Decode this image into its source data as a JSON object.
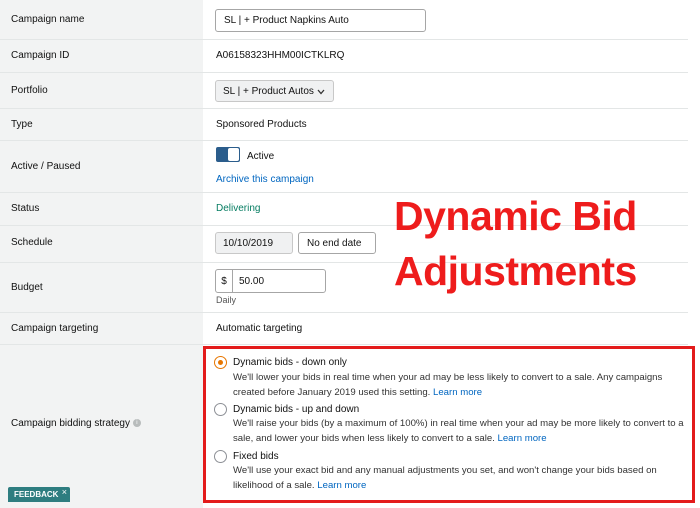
{
  "rows": {
    "campaign_name": {
      "label": "Campaign name",
      "value": "SL | + Product Napkins Auto"
    },
    "campaign_id": {
      "label": "Campaign ID",
      "value": "A06158323HHM00ICTKLRQ"
    },
    "portfolio": {
      "label": "Portfolio",
      "value": "SL | + Product Autos"
    },
    "type": {
      "label": "Type",
      "value": "Sponsored Products"
    },
    "active_paused": {
      "label": "Active / Paused",
      "toggle_label": "Active",
      "archive_link": "Archive this campaign"
    },
    "status": {
      "label": "Status",
      "value": "Delivering"
    },
    "schedule": {
      "label": "Schedule",
      "start_date": "10/10/2019",
      "end_date": "No end date"
    },
    "budget": {
      "label": "Budget",
      "currency": "$",
      "value": "50.00",
      "period": "Daily"
    },
    "campaign_targeting": {
      "label": "Campaign targeting",
      "value": "Automatic targeting"
    },
    "bidding_strategy": {
      "label": "Campaign bidding strategy",
      "info_icon": "i",
      "options": [
        {
          "title": "Dynamic bids - down only",
          "desc": "We'll lower your bids in real time when your ad may be less likely to convert to a sale. Any campaigns created before January 2019 used this setting.",
          "link": "Learn more",
          "selected": true
        },
        {
          "title": "Dynamic bids - up and down",
          "desc": "We'll raise your bids (by a maximum of 100%) in real time when your ad may be more likely to convert to a sale, and lower your bids when less likely to convert to a sale.",
          "link": "Learn more",
          "selected": false
        },
        {
          "title": "Fixed bids",
          "desc": "We'll use your exact bid and any manual adjustments you set, and won't change your bids based on likelihood of a sale.",
          "link": "Learn more",
          "selected": false
        }
      ]
    }
  },
  "overlay": {
    "line1": "Dynamic Bid",
    "line2": "Adjustments"
  },
  "feedback": {
    "label": "FEEDBACK",
    "close": "×"
  },
  "colors": {
    "link": "#0066c0",
    "status_green": "#067d62",
    "overlay_red": "#ee1c1c",
    "radio_orange": "#e77600",
    "feedback_teal": "#2e7d80"
  },
  "icons": {
    "portfolio_select": "chevron-down-icon",
    "bidding_info": "info-icon"
  }
}
